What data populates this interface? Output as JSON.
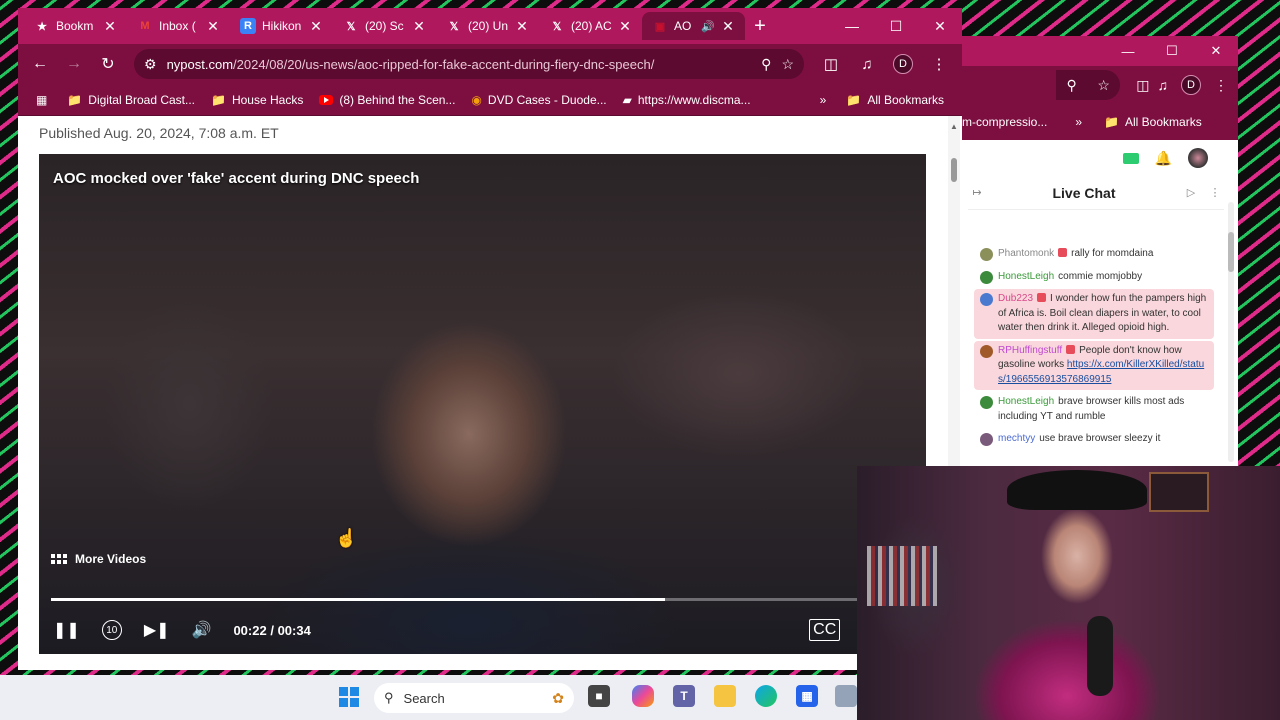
{
  "browser": {
    "tabs": [
      {
        "title": "Bookm",
        "favicon": "star-icon",
        "color": "#ffffff"
      },
      {
        "title": "Inbox (",
        "favicon": "gmail-icon",
        "color": "#ea4335"
      },
      {
        "title": "Hikikon",
        "favicon": "r-icon",
        "color": "#3b82f6"
      },
      {
        "title": "(20) Sc",
        "favicon": "x-icon",
        "color": "#000000"
      },
      {
        "title": "(20) Un",
        "favicon": "x-icon",
        "color": "#000000"
      },
      {
        "title": "(20) AC",
        "favicon": "x-icon",
        "color": "#000000"
      },
      {
        "title": "AO",
        "favicon": "nypost-icon",
        "color": "#c8102e"
      }
    ],
    "new_tab": "+",
    "url_host": "nypost.com",
    "url_path": "/2024/08/20/us-news/aoc-ripped-for-fake-accent-during-fiery-dnc-speech/",
    "profile_initial": "D",
    "bookmarks": [
      {
        "label": "Digital Broad Cast...",
        "icon": "folder-icon"
      },
      {
        "label": "House Hacks",
        "icon": "folder-icon"
      },
      {
        "label": "(8) Behind the Scen...",
        "icon": "youtube-icon"
      },
      {
        "label": "DVD Cases - Duode...",
        "icon": "dvd-icon"
      },
      {
        "label": "https://www.discma...",
        "icon": "discma-icon"
      }
    ],
    "overflow": "»",
    "all_bookmarks": "All Bookmarks"
  },
  "article": {
    "published": "Published Aug. 20, 2024, 7:08 a.m. ET"
  },
  "video": {
    "title": "AOC mocked over 'fake' accent during DNC speech",
    "more_videos": "More Videos",
    "time_current": "00:22",
    "time_sep": "/",
    "time_total": "00:34",
    "progress": 0.71,
    "replay_label": "10"
  },
  "browser2": {
    "bookmark_partial": "m-compressio...",
    "overflow": "»",
    "all_bookmarks": "All Bookmarks",
    "profile_initial": "D"
  },
  "chat": {
    "title": "Live Chat",
    "messages": [
      {
        "user": "Phantomonk",
        "color": "#8b8f5a",
        "badge": true,
        "text": "rally for momdaina",
        "highlight": false,
        "user_color": "#888888"
      },
      {
        "user": "HonestLeigh",
        "color": "#3c8a3c",
        "badge": false,
        "text": "commie momjobby",
        "highlight": false,
        "user_color": "#3a9a3a"
      },
      {
        "user": "Dub223",
        "color": "#4a7ad0",
        "badge": true,
        "text": "I wonder how fun the pampers high of Africa is. Boil clean diapers in water, to cool water then drink it. Alleged opioid high.",
        "highlight": true,
        "user_color": "#d84a8a"
      },
      {
        "user": "RPHuffingstuff",
        "color": "#a05a2a",
        "badge": true,
        "text": "People don't know how gasoline works ",
        "link": "https://x.com/KillerXKilled/status/1966556913576869915",
        "highlight": true,
        "user_color": "#c04ad0"
      },
      {
        "user": "HonestLeigh",
        "color": "#3c8a3c",
        "badge": false,
        "text": "brave browser kills most ads including YT and rumble",
        "highlight": false,
        "user_color": "#3a9a3a"
      },
      {
        "user": "mechtyy",
        "color": "#7a5a7a",
        "badge": false,
        "text": "use brave browser sleezy it",
        "highlight": false,
        "user_color": "#4a6ad0"
      }
    ]
  },
  "taskbar": {
    "search_label": "Search"
  }
}
